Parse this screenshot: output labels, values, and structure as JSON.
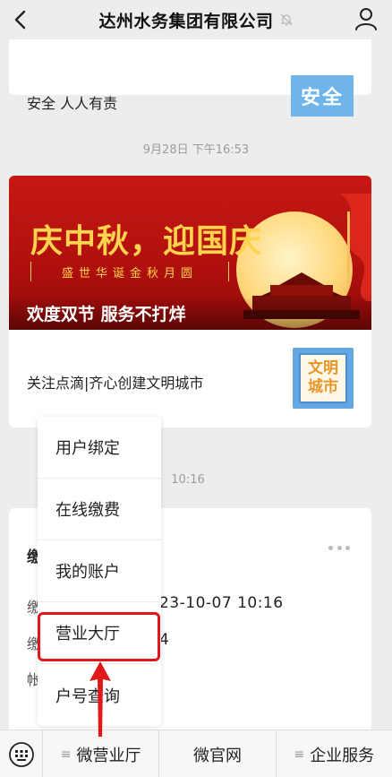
{
  "header": {
    "title": "达州水务集团有限公司"
  },
  "feed": {
    "card1": {
      "text": "安全 人人有责",
      "thumb_text": "安全"
    },
    "time1": "9月28日 下午16:53",
    "card2": {
      "banner_title": "庆中秋，迎国庆",
      "banner_subtitle": "盛世华诞金秋月圆",
      "banner_caption": "欢度双节 服务不打烊",
      "article_title": "关注点滴|齐心创建文明城市",
      "thumb_line1": "文明",
      "thumb_line2": "城市"
    },
    "time2": "10:16",
    "card3": {
      "title_partial": "缴",
      "row1_label": "缴",
      "row1_value": "23-10-07 10:16",
      "row2_label": "缴",
      "row2_value": "4",
      "row3_label": "帐"
    }
  },
  "popup_menu": {
    "items": [
      "用户绑定",
      "在线缴费",
      "我的账户",
      "营业大厅",
      "户号查询"
    ],
    "highlighted": "营业大厅"
  },
  "bottom_bar": {
    "menus": [
      "微营业厅",
      "微官网",
      "企业服务"
    ]
  },
  "colors": {
    "highlight": "#e0181c",
    "banner_red": "#c61812",
    "banner_gold": "#ffd34d"
  }
}
